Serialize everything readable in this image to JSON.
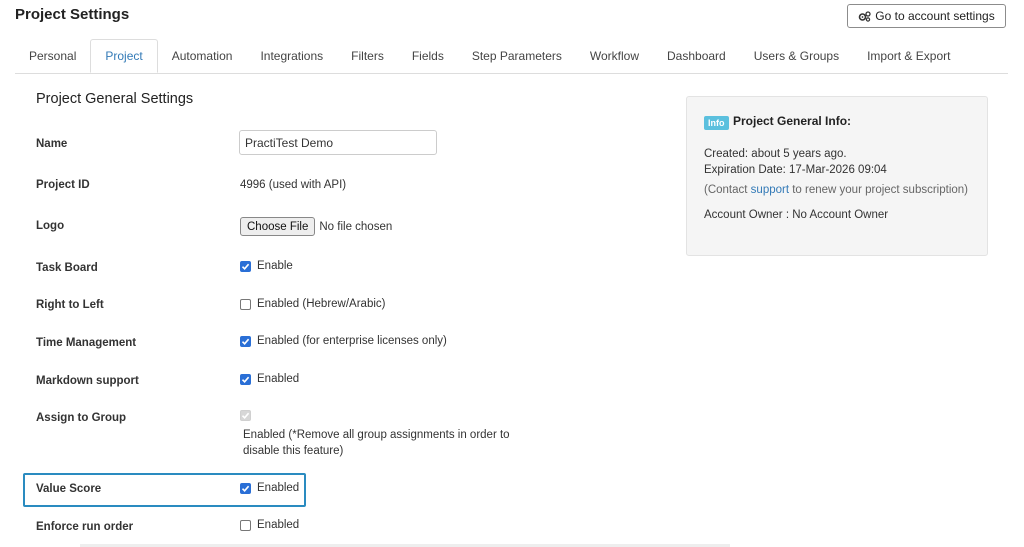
{
  "header": {
    "title": "Project Settings",
    "account_button": "Go to account settings"
  },
  "tabs": [
    {
      "label": "Personal",
      "active": false
    },
    {
      "label": "Project",
      "active": true
    },
    {
      "label": "Automation",
      "active": false
    },
    {
      "label": "Integrations",
      "active": false
    },
    {
      "label": "Filters",
      "active": false
    },
    {
      "label": "Fields",
      "active": false
    },
    {
      "label": "Step Parameters",
      "active": false
    },
    {
      "label": "Workflow",
      "active": false
    },
    {
      "label": "Dashboard",
      "active": false
    },
    {
      "label": "Users & Groups",
      "active": false
    },
    {
      "label": "Import & Export",
      "active": false
    }
  ],
  "form": {
    "section_title": "Project General Settings",
    "name": {
      "label": "Name",
      "value": "PractiTest Demo"
    },
    "project_id": {
      "label": "Project ID",
      "value": "4996 (used with API)"
    },
    "logo": {
      "label": "Logo",
      "button": "Choose File",
      "status": "No file chosen"
    },
    "task_board": {
      "label": "Task Board",
      "text": "Enable",
      "checked": true
    },
    "rtl": {
      "label": "Right to Left",
      "text": "Enabled (Hebrew/Arabic)",
      "checked": false
    },
    "time_mgmt": {
      "label": "Time Management",
      "text": "Enabled (for enterprise licenses only)",
      "checked": true
    },
    "markdown": {
      "label": "Markdown support",
      "text": "Enabled",
      "checked": true
    },
    "assign_group": {
      "label": "Assign to Group",
      "text": "Enabled (*Remove all group assignments in order to disable this feature)",
      "checked": true,
      "disabled": true
    },
    "value_score": {
      "label": "Value Score",
      "text": "Enabled",
      "checked": true
    },
    "enforce_run": {
      "label": "Enforce run order",
      "text": "Enabled",
      "checked": false
    }
  },
  "info_panel": {
    "badge": "Info",
    "title": "Project General Info:",
    "created": "Created: about 5 years ago.",
    "expiration": "Expiration Date: 17-Mar-2026 09:04",
    "contact_prefix": "(Contact ",
    "contact_link": "support",
    "contact_suffix": " to renew your project subscription)",
    "owner": "Account Owner : No Account Owner"
  },
  "colors": {
    "accent": "#337ab7",
    "checkbox": "#2a6fd6",
    "highlight_border": "#2a8bc0",
    "info_badge": "#5bc0de"
  }
}
